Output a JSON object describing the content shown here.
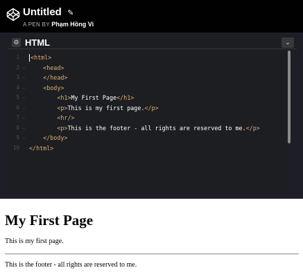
{
  "header": {
    "pen_title": "Untitled",
    "byline_prefix": "A PEN BY",
    "author": "Phạm Hồng Vi"
  },
  "panel": {
    "title": "HTML"
  },
  "editor": {
    "lines": [
      {
        "num": "1",
        "fold": "",
        "indent": "",
        "parts": [
          {
            "t": "<html>",
            "c": "tag"
          }
        ]
      },
      {
        "num": "2",
        "fold": "–",
        "indent": "    ",
        "parts": [
          {
            "t": "<head>",
            "c": "tag"
          }
        ]
      },
      {
        "num": "3",
        "fold": "–",
        "indent": "    ",
        "parts": [
          {
            "t": "</head>",
            "c": "tag"
          }
        ]
      },
      {
        "num": "4",
        "fold": "–",
        "indent": "    ",
        "parts": [
          {
            "t": "<body>",
            "c": "tag"
          }
        ]
      },
      {
        "num": "5",
        "fold": "–",
        "indent": "        ",
        "parts": [
          {
            "t": "<h1>",
            "c": "tag"
          },
          {
            "t": "My First Page",
            "c": "txt"
          },
          {
            "t": "</h1>",
            "c": "tag"
          }
        ]
      },
      {
        "num": "6",
        "fold": "–",
        "indent": "        ",
        "parts": [
          {
            "t": "<p>",
            "c": "tag"
          },
          {
            "t": "This is my first page.",
            "c": "txt"
          },
          {
            "t": "</p>",
            "c": "tag"
          }
        ]
      },
      {
        "num": "7",
        "fold": "–",
        "indent": "        ",
        "parts": [
          {
            "t": "<hr/>",
            "c": "tag"
          }
        ]
      },
      {
        "num": "8",
        "fold": "–",
        "indent": "        ",
        "parts": [
          {
            "t": "<p>",
            "c": "tag"
          },
          {
            "t": "This is the footer - all rights are reserved to me.",
            "c": "txt"
          },
          {
            "t": "</p>",
            "c": "tag"
          }
        ]
      },
      {
        "num": "9",
        "fold": "–",
        "indent": "    ",
        "parts": [
          {
            "t": "</body>",
            "c": "tag"
          }
        ]
      },
      {
        "num": "10",
        "fold": "",
        "indent": "",
        "parts": [
          {
            "t": "</html>",
            "c": "tag"
          }
        ]
      }
    ]
  },
  "preview": {
    "heading": "My First Page",
    "paragraph": "This is my first page.",
    "footer": "This is the footer - all rights are reserved to me."
  },
  "colors": {
    "header_bg": "#010101",
    "editor_bg": "#1d1e22",
    "tag": "#d8ae6e",
    "text": "#ffffff"
  }
}
